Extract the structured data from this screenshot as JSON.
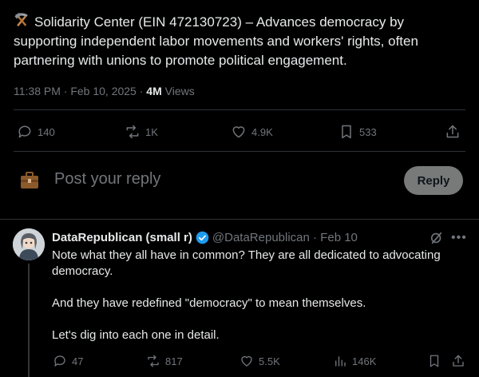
{
  "tweet": {
    "emoji": "hammer-and-pick",
    "text": "Solidarity Center (EIN 472130723) – Advances democracy by supporting independent labor movements and workers' rights, often partnering with unions to promote political engagement.",
    "time": "11:38 PM · Feb 10, 2025 · ",
    "views_count": "4M",
    "views_label": " Views",
    "replies": "140",
    "reposts": "1K",
    "likes": "4.9K",
    "bookmarks": "533"
  },
  "composer": {
    "placeholder": "Post your reply",
    "reply_button": "Reply"
  },
  "reply": {
    "name": "DataRepublican (small r)",
    "handle": "@DataRepublican · Feb 10",
    "paragraphs": [
      "Note what they all have in common? They are all dedicated to advocating democracy.",
      "And they have redefined \"democracy\" to mean themselves.",
      "Let's dig into each one in detail."
    ],
    "replies": "47",
    "reposts": "817",
    "likes": "5.5K",
    "views": "146K"
  },
  "colors": {
    "background": "#000000",
    "text": "#e7e9ea",
    "muted": "#71767b",
    "divider": "#2f3336",
    "verified": "#1d9bf0",
    "reply_button": "#787a7a"
  }
}
